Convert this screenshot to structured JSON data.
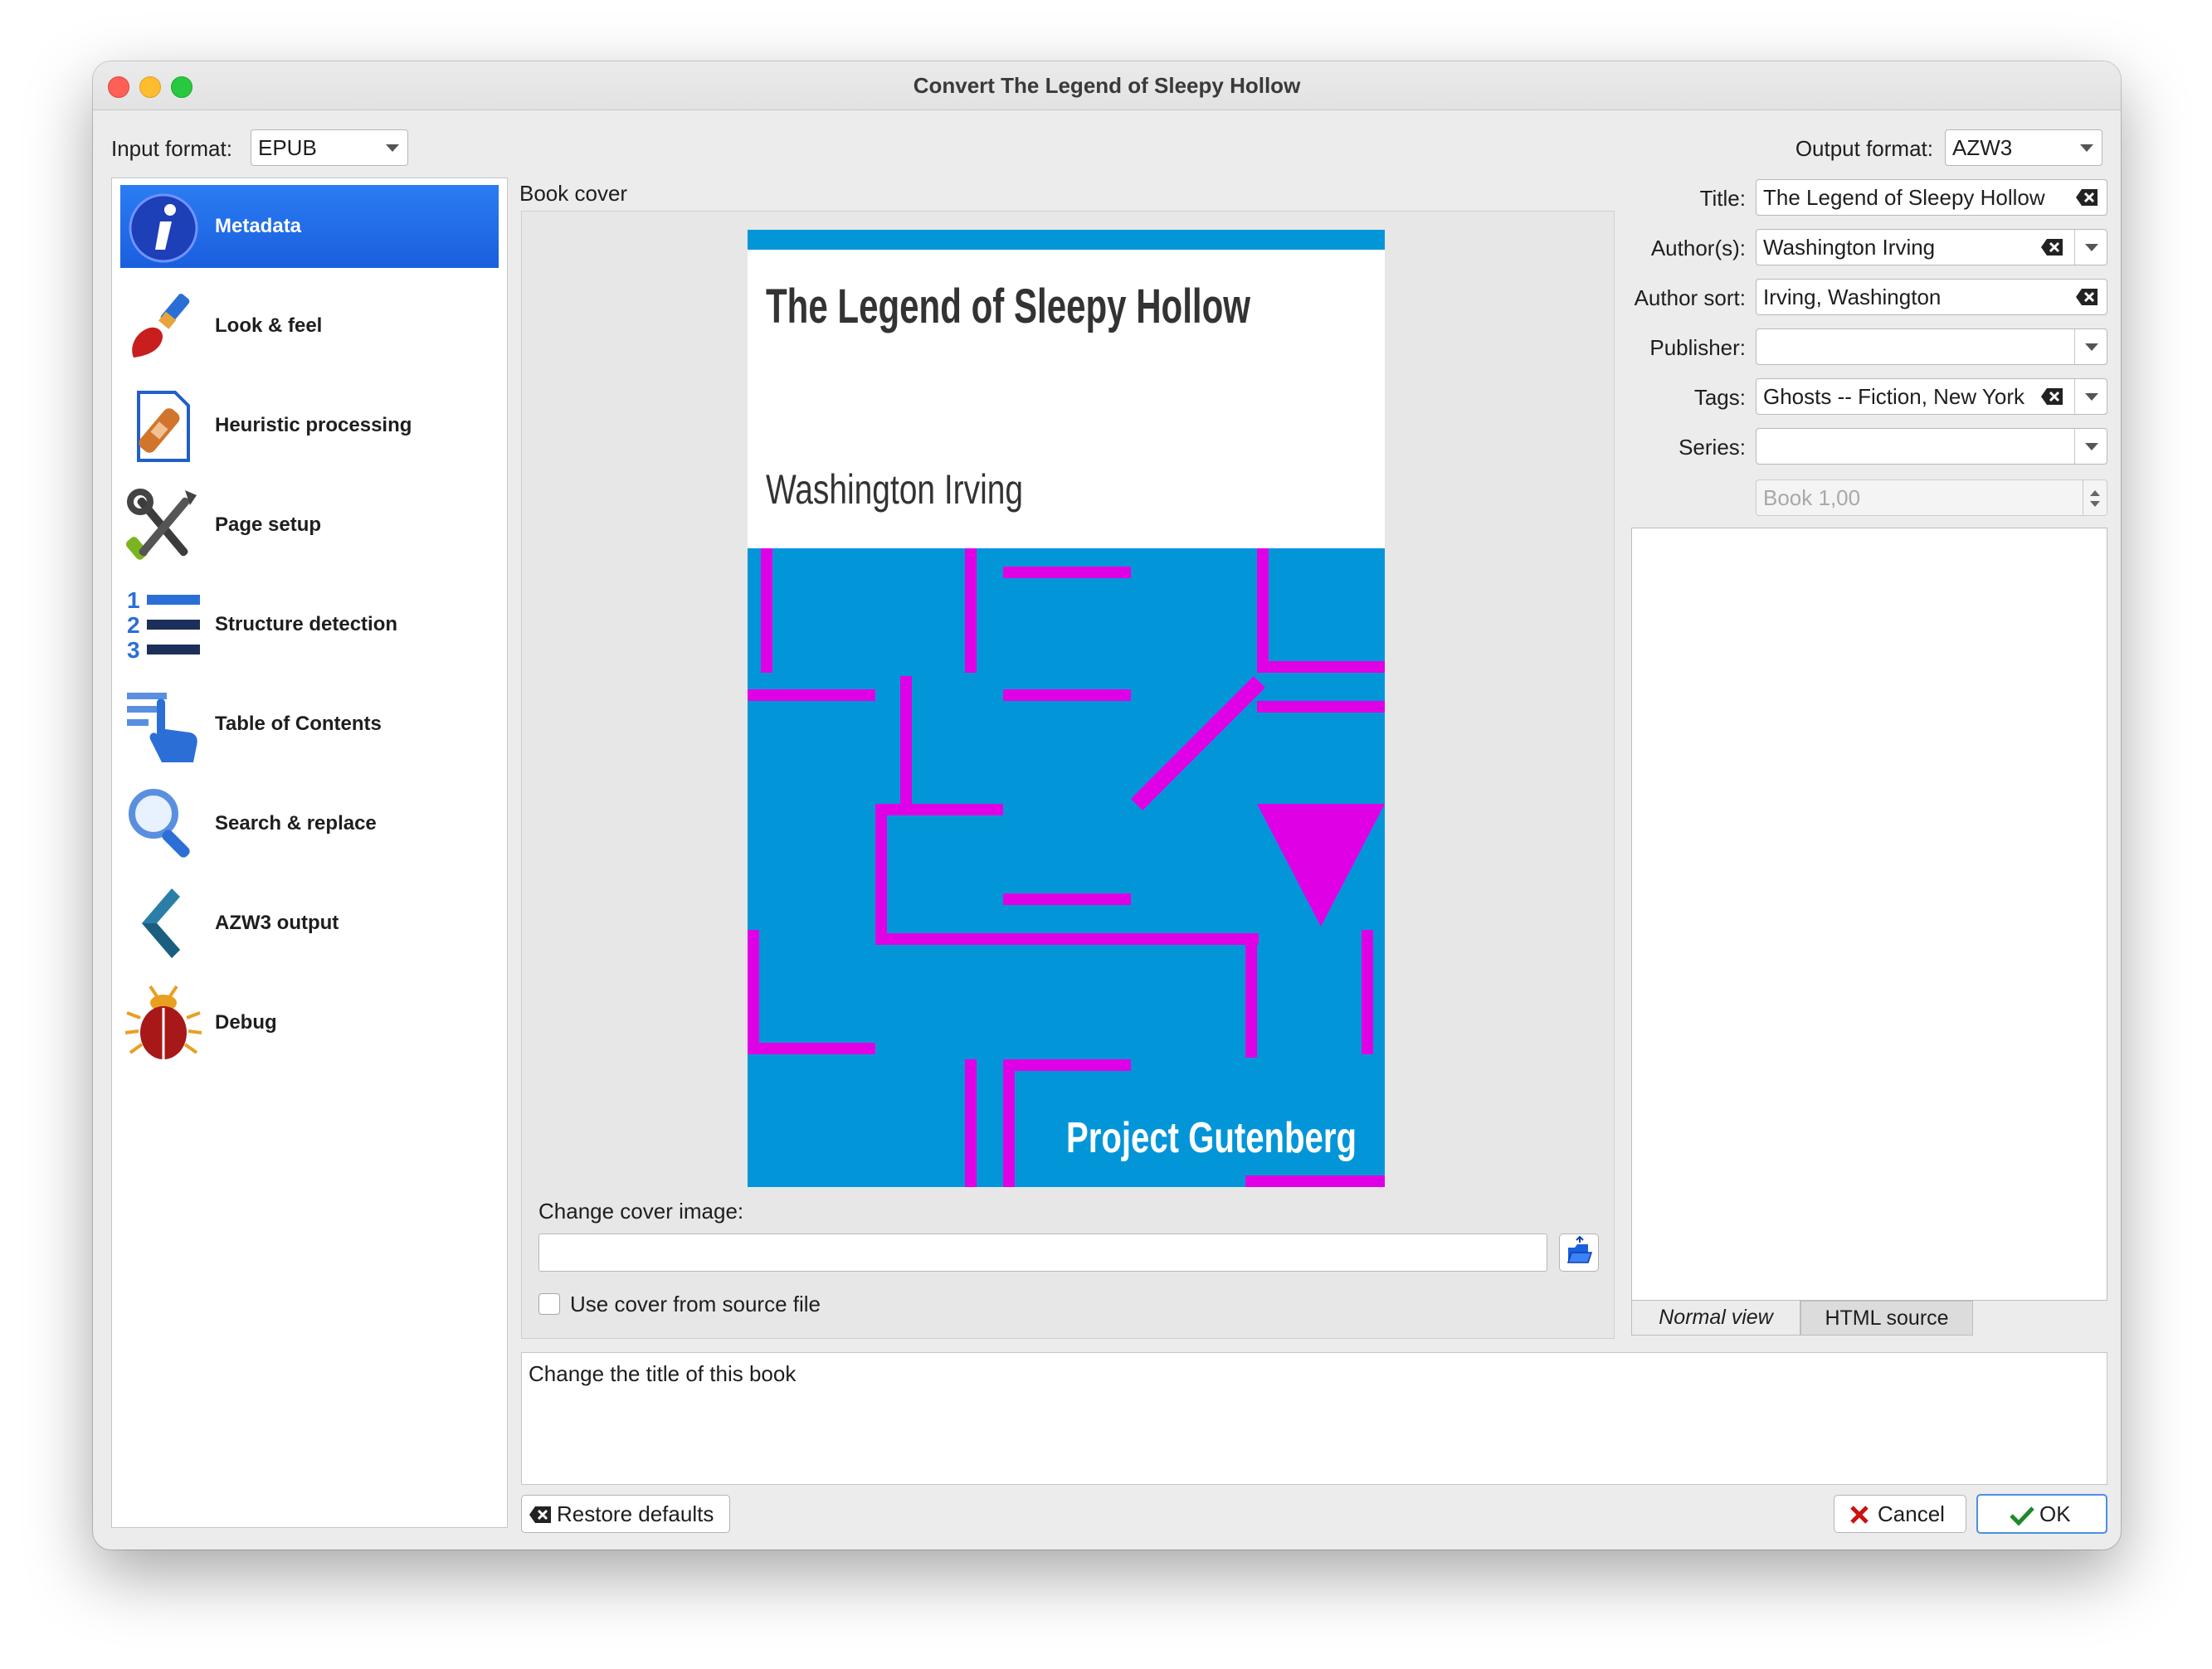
{
  "window": {
    "title": "Convert The Legend of Sleepy Hollow"
  },
  "formats": {
    "input_label": "Input format:",
    "input_value": "EPUB",
    "output_label": "Output format:",
    "output_value": "AZW3"
  },
  "sidebar": {
    "items": [
      {
        "label": "Metadata",
        "icon": "info-icon",
        "selected": true
      },
      {
        "label": "Look & feel",
        "icon": "paintbrush-icon"
      },
      {
        "label": "Heuristic processing",
        "icon": "bandaid-document-icon"
      },
      {
        "label": "Page setup",
        "icon": "tools-icon"
      },
      {
        "label": "Structure detection",
        "icon": "numbered-list-icon"
      },
      {
        "label": "Table of Contents",
        "icon": "toc-pointer-icon"
      },
      {
        "label": "Search & replace",
        "icon": "magnifier-icon"
      },
      {
        "label": "AZW3 output",
        "icon": "chevron-left-icon"
      },
      {
        "label": "Debug",
        "icon": "bug-icon"
      }
    ]
  },
  "cover": {
    "group_label": "Book cover",
    "title": "The Legend of Sleepy Hollow",
    "author": "Washington Irving",
    "publisher": "Project Gutenberg",
    "colors": {
      "background": "#0296d8",
      "maze": "#e000e6",
      "panel": "#ffffff"
    },
    "change_label": "Change cover image:",
    "path_value": "",
    "use_source_label": "Use cover from source file",
    "use_source_checked": false
  },
  "metadata": {
    "title_label": "Title:",
    "title_value": "The Legend of Sleepy Hollow",
    "authors_label": "Author(s):",
    "authors_value": "Washington Irving",
    "author_sort_label": "Author sort:",
    "author_sort_value": "Irving, Washington",
    "publisher_label": "Publisher:",
    "publisher_value": "",
    "tags_label": "Tags:",
    "tags_value": "Ghosts -- Fiction, New York",
    "series_label": "Series:",
    "series_value": "",
    "series_index_value": "Book 1,00"
  },
  "comments_tabs": {
    "normal": "Normal view",
    "html": "HTML source"
  },
  "help_text": "Change the title of this book",
  "buttons": {
    "restore": "Restore defaults",
    "cancel": "Cancel",
    "ok": "OK"
  }
}
